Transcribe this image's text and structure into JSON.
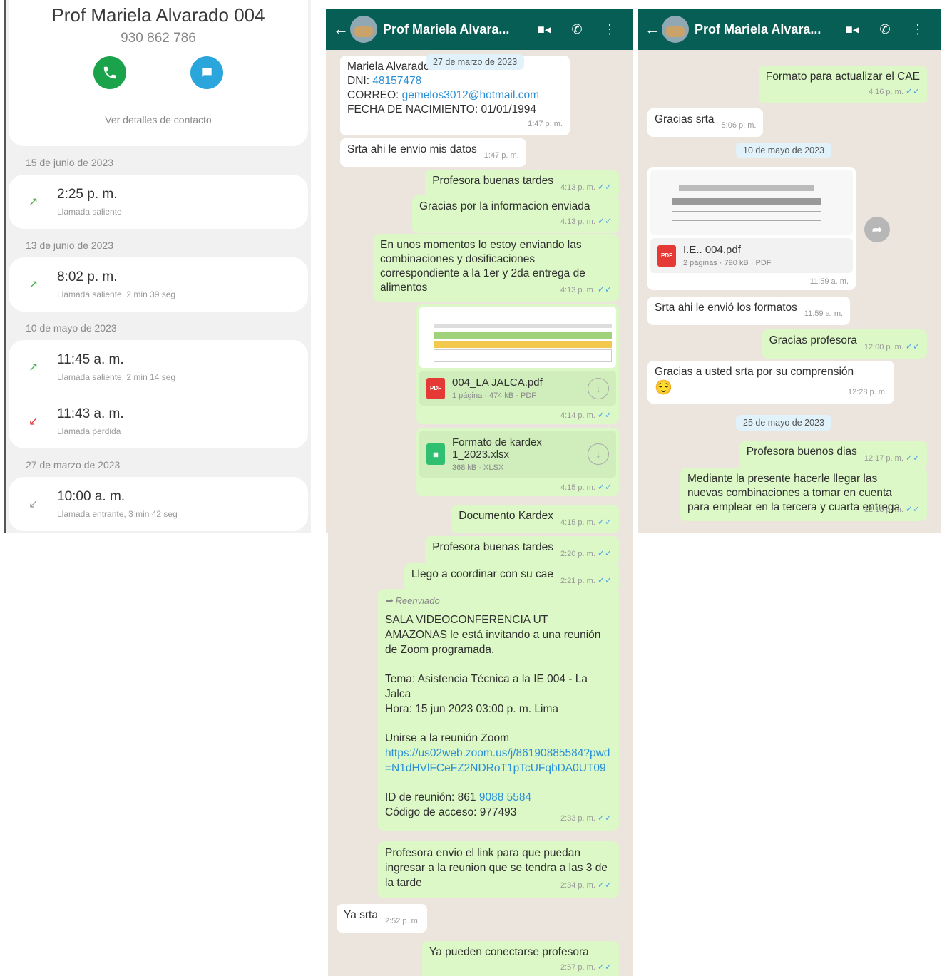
{
  "contact": {
    "name": "Prof Mariela Alvarado 004",
    "phone": "930 862 786",
    "details_link": "Ver detalles de contacto",
    "calls": [
      {
        "date": "15 de junio de 2023",
        "time": "2:25 p. m.",
        "desc": "Llamada saliente"
      },
      {
        "date": "13 de junio de 2023",
        "time": "8:02 p. m.",
        "desc": "Llamada saliente, 2 min 39 seg"
      },
      {
        "date": "10 de mayo de 2023",
        "time": "11:45 a. m.",
        "desc": "Llamada saliente, 2 min 14 seg"
      },
      {
        "date": "",
        "time": "11:43 a. m.",
        "desc": "Llamada perdida"
      },
      {
        "date": "27 de marzo de 2023",
        "time": "10:00 a. m.",
        "desc": "Llamada entrante, 3 min 42 seg"
      }
    ]
  },
  "chat_title": "Prof Mariela Alvara...",
  "chat1": {
    "date_pill": "27 de marzo de 2023",
    "m1": {
      "name": "Mariela Alvarado Ba",
      "dni_label": "DNI:",
      "dni": "48157478",
      "correo_label": "CORREO:",
      "correo": "gemelos3012@hotmail.com",
      "fecha": "FECHA DE NACIMIENTO: 01/01/1994",
      "time": "1:47 p. m."
    },
    "m2": {
      "text": "Srta ahi le envio mis datos",
      "time": "1:47 p. m."
    },
    "m3": {
      "text": "Profesora buenas tardes",
      "time": "4:13 p. m."
    },
    "m4": {
      "text": "Gracias por la informacion enviada",
      "time": "4:13 p. m."
    },
    "m5": {
      "text": "En unos momentos lo estoy enviando las combinaciones y dosificaciones correspondiente a la 1er y 2da entrega de alimentos",
      "time": "4:13 p. m."
    },
    "doc1": {
      "name": "004_LA JALCA.pdf",
      "meta": "1 página · 474 kB · PDF",
      "time": "4:14 p. m.",
      "badge": "PDF"
    },
    "doc2": {
      "name": "Formato de kardex 1_2023.xlsx",
      "meta": "368 kB · XLSX",
      "time": "4:15 p. m."
    },
    "m6": {
      "text": "Documento Kardex",
      "time": "4:15 p. m."
    }
  },
  "chat2": {
    "m1": {
      "text": "Formato para actualizar el CAE",
      "time": "4:16 p. m."
    },
    "m2": {
      "text": "Gracias srta",
      "time": "5:06 p. m."
    },
    "date_pill": "10 de mayo de 2023",
    "doc": {
      "name": "I.E.. 004.pdf",
      "meta": "2 páginas · 790 kB · PDF",
      "time": "11:59 a. m.",
      "badge": "PDF"
    },
    "m3": {
      "text": "Srta ahi le envió los formatos",
      "time": "11:59 a. m."
    },
    "m4": {
      "text": "Gracias profesora",
      "time": "12:00 p. m."
    },
    "m5": {
      "text": "Gracias a usted srta  por su comprensión",
      "emoji": "😌",
      "time": "12:28 p. m."
    },
    "date_pill2": "25 de mayo de 2023",
    "m6": {
      "text": "Profesora buenos dias",
      "time": "12:17 p. m."
    },
    "m7": {
      "text": "Mediante la presente hacerle llegar las nuevas combinaciones a tomar en cuenta para emplear en la tercera y cuarta entrega",
      "time": "12:18 p. m."
    }
  },
  "chat3": {
    "m1": {
      "text": "Profesora buenas tardes",
      "time": "2:20 p. m."
    },
    "m2": {
      "text": "Llego a coordinar con su cae",
      "time": "2:21 p. m."
    },
    "m3": {
      "forwarded": "Reenviado",
      "p1": "SALA VIDEOCONFERENCIA UT AMAZONAS le está invitando a una reunión de Zoom programada.",
      "p2": "Tema: Asistencia Técnica a la IE 004 - La Jalca",
      "p3": "Hora: 15 jun 2023 03:00 p. m. Lima",
      "p4": "Unirse a la reunión Zoom",
      "link": "https://us02web.zoom.us/j/86190885584?pwd=N1dHVlFCeFZ2NDRoT1pTcUFqbDA0UT09",
      "id_label": "ID de reunión: 861",
      "id_link": "9088 5584",
      "code": "Código de acceso: 977493",
      "time": "2:33 p. m."
    },
    "m4": {
      "text": "Profesora envio el link para que puedan ingresar a la reunion que se tendra a las 3 de la tarde",
      "time": "2:34 p. m."
    },
    "m5": {
      "text": "Ya srta",
      "time": "2:52 p. m."
    },
    "m6": {
      "text": "Ya pueden conectarse profesora",
      "time": "2:57 p. m."
    }
  }
}
